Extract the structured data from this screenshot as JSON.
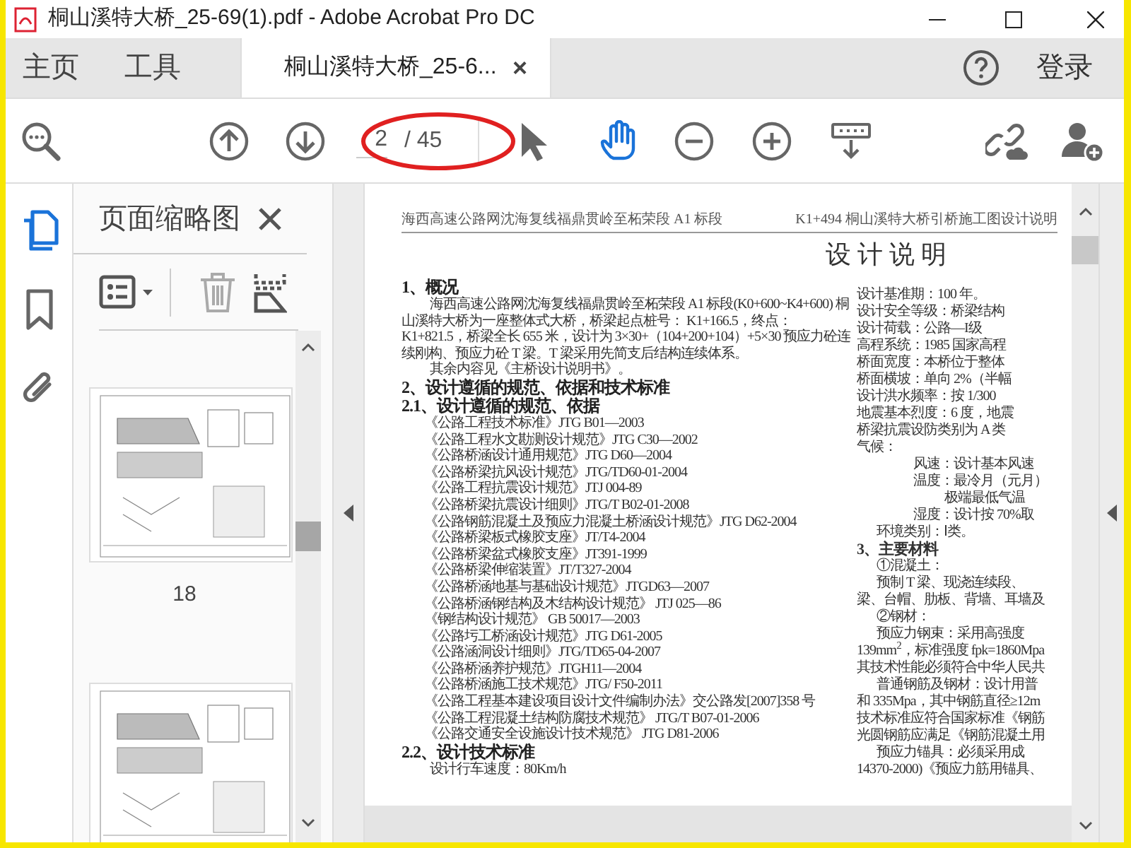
{
  "window": {
    "title": "桐山溪特大桥_25-69(1).pdf - Adobe Acrobat Pro DC"
  },
  "tabs": [
    {
      "label": "主页",
      "selected": false
    },
    {
      "label": "工具",
      "selected": false
    },
    {
      "label": "桐山溪特大桥_25-6...",
      "selected": true,
      "close": "×"
    }
  ],
  "sign_in": "登录",
  "toolbar": {
    "page_value": "2",
    "page_count": "/ 45",
    "tools": [
      {
        "kind": "select",
        "selected": false
      },
      {
        "kind": "hand",
        "selected": true
      }
    ]
  },
  "side_tools": [
    {
      "kind": "pages",
      "selected": true
    },
    {
      "kind": "bookmarks",
      "selected": false
    },
    {
      "kind": "attachments",
      "selected": false
    }
  ],
  "thumbnails_panel": {
    "title": "页面缩略图",
    "page_label": "18"
  },
  "document": {
    "header_left": "海西高速公路网沈海复线福鼎贯岭至柘荣段 A1 标段",
    "header_right": "K1+494 桐山溪特大桥引桥施工图设计说明",
    "title": "设 计 说 明",
    "left_column": [
      {
        "kind": "heading",
        "text": "1、概况"
      },
      {
        "kind": "paragraph",
        "text": "海西高速公路网沈海复线福鼎贯岭至柘荣段 A1 标段(K0+600~K4+600) 桐山溪特大桥为一座整体式大桥，桥梁起点桩号： K1+166.5，终点： K1+821.5，桥梁全长 655 米，设计为 3×30+（104+200+104）+5×30 预应力砼连续刚构、预应力砼 T 梁。T 梁采用先简支后结构连续体系。"
      },
      {
        "kind": "paragraph",
        "text": "其余内容见《主桥设计说明书》。"
      },
      {
        "kind": "heading",
        "text": "2、设计遵循的规范、依据和技术标准"
      },
      {
        "kind": "heading",
        "text": "2.1、设计遵循的规范、依据"
      },
      {
        "kind": "item",
        "text": "《公路工程技术标准》JTG B01—2003"
      },
      {
        "kind": "item",
        "text": "《公路工程水文勘测设计规范》JTG C30—2002"
      },
      {
        "kind": "item",
        "text": "《公路桥涵设计通用规范》JTG D60—2004"
      },
      {
        "kind": "item",
        "text": "《公路桥梁抗风设计规范》JTG/TD60-01-2004"
      },
      {
        "kind": "item",
        "text": "《公路工程抗震设计规范》JTJ 004-89"
      },
      {
        "kind": "item",
        "text": "《公路桥梁抗震设计细则》JTG/T B02-01-2008"
      },
      {
        "kind": "item",
        "text": "《公路钢筋混凝土及预应力混凝土桥涵设计规范》JTG D62-2004"
      },
      {
        "kind": "item",
        "text": "《公路桥梁板式橡胶支座》JT/T4-2004"
      },
      {
        "kind": "item",
        "text": "《公路桥梁盆式橡胶支座》JT391-1999"
      },
      {
        "kind": "item",
        "text": "《公路桥梁伸缩装置》JT/T327-2004"
      },
      {
        "kind": "item",
        "text": "《公路桥涵地基与基础设计规范》JTGD63—2007"
      },
      {
        "kind": "item",
        "text": "《公路桥涵钢结构及木结构设计规范》 JTJ 025—86"
      },
      {
        "kind": "item",
        "text": "《钢结构设计规范》 GB 50017—2003"
      },
      {
        "kind": "item",
        "text": "《公路圬工桥涵设计规范》JTG D61-2005"
      },
      {
        "kind": "item",
        "text": "《公路涵洞设计细则》JTG/TD65-04-2007"
      },
      {
        "kind": "item",
        "text": "《公路桥涵养护规范》JTGH11—2004"
      },
      {
        "kind": "item",
        "text": "《公路桥涵施工技术规范》JTG/ F50-2011"
      },
      {
        "kind": "item",
        "text": "《公路工程基本建设项目设计文件编制办法》交公路发[2007]358 号"
      },
      {
        "kind": "item",
        "text": "《公路工程混凝土结构防腐技术规范》 JTG/T B07-01-2006"
      },
      {
        "kind": "item",
        "text": "《公路交通安全设施设计技术规范》 JTG D81-2006"
      },
      {
        "kind": "heading",
        "text": "2.2、设计技术标准"
      },
      {
        "kind": "paragraph",
        "text": "设计行车速度：80Km/h"
      }
    ],
    "right_column": [
      {
        "kind": "line",
        "text": "设计基准期：100 年。"
      },
      {
        "kind": "line",
        "text": "设计安全等级：桥梁结构"
      },
      {
        "kind": "line",
        "text": "设计荷载：公路—I级"
      },
      {
        "kind": "line",
        "text": "高程系统：1985 国家高程"
      },
      {
        "kind": "line",
        "text": "桥面宽度：本桥位于整体"
      },
      {
        "kind": "line",
        "text": "桥面横坡：单向 2%（半幅"
      },
      {
        "kind": "line",
        "text": "设计洪水频率：按 1/300"
      },
      {
        "kind": "line",
        "text": "地震基本烈度：6 度，地震"
      },
      {
        "kind": "line",
        "text": "桥梁抗震设防类别为 A 类"
      },
      {
        "kind": "line",
        "text": "气候："
      },
      {
        "kind": "indent2",
        "text": "风速：设计基本风速"
      },
      {
        "kind": "indent2",
        "text": "温度：最冷月（元月）"
      },
      {
        "kind": "indent3",
        "text": "极端最低气温"
      },
      {
        "kind": "indent2",
        "text": "湿度：设计按 70%取"
      },
      {
        "kind": "indent",
        "text": "环境类别：Ⅰ类。"
      },
      {
        "kind": "heading",
        "text": "3、主要材料"
      },
      {
        "kind": "indent",
        "text": "①混凝土："
      },
      {
        "kind": "indent",
        "text": "预制 T 梁、现浇连续段、"
      },
      {
        "kind": "line",
        "text": "梁、台帽、肋板、背墙、耳墙及"
      },
      {
        "kind": "indent",
        "text": "②钢材："
      },
      {
        "kind": "indent",
        "text": "预应力钢束：采用高强度"
      },
      {
        "kind": "line",
        "text": "139mm$^{2}$，标准强度 fpk=1860Mpa"
      },
      {
        "kind": "line",
        "text": "其技术性能必须符合中华人民共"
      },
      {
        "kind": "indent",
        "text": "普通钢筋及钢材：设计用普"
      },
      {
        "kind": "line",
        "text": "和 335Mpa，其中钢筋直径≥12m"
      },
      {
        "kind": "line",
        "text": "技术标准应符合国家标准《钢筋"
      },
      {
        "kind": "line",
        "text": "光圆钢筋应满足《钢筋混凝土用"
      },
      {
        "kind": "indent",
        "text": "预应力锚具：必须采用成"
      },
      {
        "kind": "line",
        "text": "14370-2000)《预应力筋用锚具、"
      }
    ]
  }
}
